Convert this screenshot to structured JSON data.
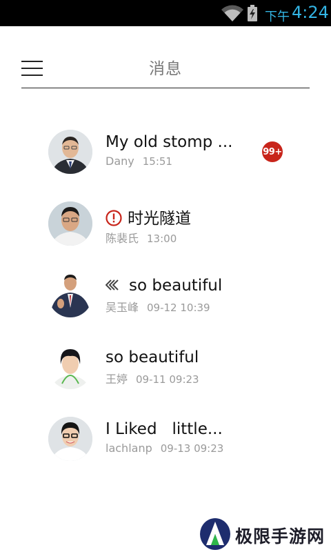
{
  "status_bar": {
    "ampm": "下午",
    "time": "4:24"
  },
  "header": {
    "title": "消息"
  },
  "conversations": [
    {
      "title": "My old stomp ...",
      "sender": "Dany",
      "time": "15:51",
      "badge": "99+"
    },
    {
      "title": "时光隧道",
      "sender": "陈裴氏",
      "time": "13:00",
      "icon": "alert-icon"
    },
    {
      "title": "so beautiful",
      "sender": "吴玉峰",
      "time": "09-12 10:39",
      "icon": "reply-icon"
    },
    {
      "title": "so beautiful",
      "sender": "王婷",
      "time": "09-11 09:23"
    },
    {
      "title": "I Liked   little...",
      "sender": "lachlanp",
      "time": "09-13 09:23"
    }
  ],
  "watermark": {
    "text": "极限手游网"
  },
  "colors": {
    "status_accent": "#33b5e5",
    "badge": "#c8251b",
    "alert": "#c8251b"
  }
}
